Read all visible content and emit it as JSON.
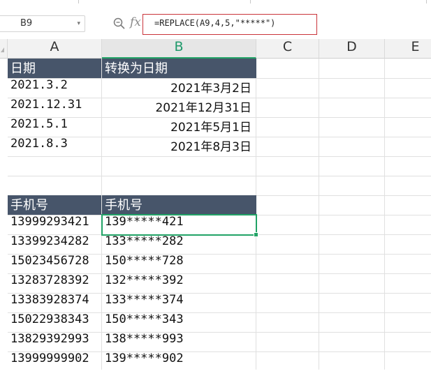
{
  "formula_bar": {
    "cell_ref": "B9",
    "dropdown_glyph": "▾",
    "fx_label": "fx",
    "formula": "=REPLACE(A9,4,5,\"*****\")"
  },
  "icons": {
    "zoom": "magnifier-zoom-icon",
    "fx": "function-fx-icon",
    "select_all": "select-all-triangle-icon"
  },
  "columns": [
    "A",
    "B",
    "C",
    "D",
    "E"
  ],
  "active_column": "B",
  "table1": {
    "header": [
      "日期",
      "转换为日期"
    ],
    "rows": [
      [
        "2021.3.2",
        "2021年3月2日"
      ],
      [
        "2021.12.31",
        "2021年12月31日"
      ],
      [
        "2021.5.1",
        "2021年5月1日"
      ],
      [
        "2021.8.3",
        "2021年8月3日"
      ]
    ]
  },
  "table2": {
    "header": [
      "手机号",
      "手机号"
    ],
    "rows": [
      [
        "13999293421",
        "139*****421"
      ],
      [
        "13399234282",
        "133*****282"
      ],
      [
        "15023456728",
        "150*****728"
      ],
      [
        "13283728392",
        "132*****392"
      ],
      [
        "13383928374",
        "133*****374"
      ],
      [
        "15022938343",
        "150*****343"
      ],
      [
        "13829392993",
        "138*****993"
      ],
      [
        "13999999902",
        "139*****902"
      ]
    ]
  },
  "colors": {
    "header_fill": "#47556a",
    "selection": "#21a366",
    "formula_outline": "#c9343a"
  }
}
